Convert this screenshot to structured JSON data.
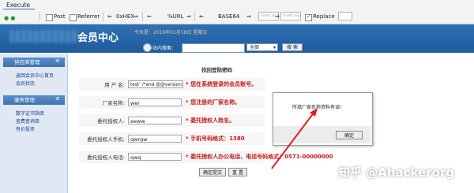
{
  "toolbar": {
    "execute_tab": "Execute",
    "post_label": "Post",
    "referrer_label": "Referrer",
    "hex_label": "0xHEX",
    "url_label": "%URL",
    "base64_label": "BASE64",
    "insert_placeholder_1": "Insert to s",
    "insert_placeholder_2": "Insert rep",
    "replace_label": "Replace",
    "replace_checked": true
  },
  "site": {
    "title": "会员中心",
    "date_text": "今天是：2019年01月18日 星期五",
    "search_label": "站内搜索：",
    "select_value": "全部",
    "search_button": "搜 索"
  },
  "sidebar": {
    "section1": {
      "title": "供应商管理",
      "items": [
        "返回会员中心首页",
        "会员状态"
      ]
    },
    "section2": {
      "title": "服务管理",
      "items": [
        "数字证书指南",
        "查费查询单",
        "有价投资"
      ]
    }
  },
  "form": {
    "title": "找回登陆密码",
    "rows": [
      {
        "label": "用 户 名:",
        "value": "test' /*and @@version>0 and",
        "hint": "* 您在系统登录的会员账号。"
      },
      {
        "label": "厂家名称:",
        "value": "wer",
        "hint": "* 您注册的厂家名称。"
      },
      {
        "label": "委托授权人:",
        "value": "eeww",
        "hint": "* 委托授权人姓名。"
      },
      {
        "label": "委托授权人手机:",
        "value": "qwrqw",
        "hint": "* 手机号码格式：1380"
      },
      {
        "label": "委托授权人电话:",
        "value": "qwq",
        "hint": "* 委托授权人办公电话，电话号码格式：0571-00000000"
      }
    ],
    "submit_button": "确定提交",
    "reset_button": "重 置"
  },
  "dialog": {
    "message": "所填厂家名称资料有误!",
    "ok_button": "确定"
  },
  "watermark": "知乎 @Ahackerorg",
  "colors": {
    "header_blue": "#2d72b5",
    "hint_red": "#c81818",
    "annotation_arrow": "#e02020"
  }
}
